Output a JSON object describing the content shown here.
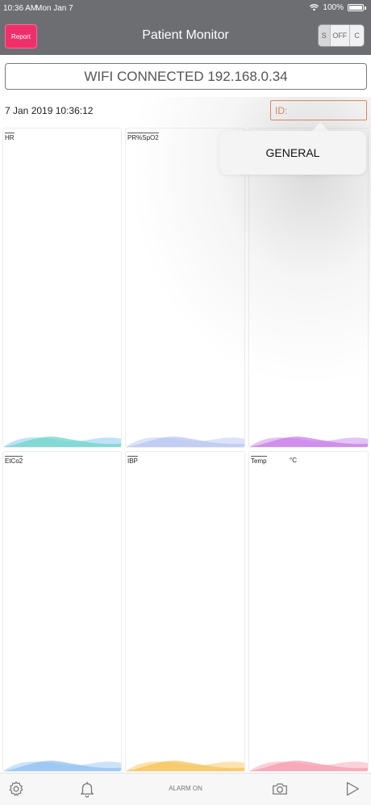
{
  "status_bar": {
    "time": "10:36 AM",
    "date": "Mon Jan 7",
    "battery": "100%"
  },
  "nav": {
    "report_label": "Report",
    "title": "Patient Monitor",
    "segments": [
      "S",
      "OFF",
      "C"
    ]
  },
  "wifi_status": "WIFI CONNECTED 192.168.0.34",
  "timestamp": "7 Jan 2019 10:36:12",
  "id_placeholder": "ID:",
  "popover": {
    "item": "GENERAL"
  },
  "panels": [
    {
      "label": "HR",
      "unit": "",
      "wave_color": "#6fd6c8",
      "wave_color2": "#a9d8f5"
    },
    {
      "label": "PR%SpO2",
      "unit": "",
      "wave_color": "#b9c6f2",
      "wave_color2": "#cfd9f7"
    },
    {
      "label": "",
      "unit": "",
      "wave_color": "#c97ee8",
      "wave_color2": "#d9b0f2"
    },
    {
      "label": "EtCo2",
      "unit": "",
      "wave_color": "#8fc0f2",
      "wave_color2": "#bcd9f7"
    },
    {
      "label": "IBP",
      "unit": "",
      "wave_color": "#f7c25a",
      "wave_color2": "#fbd98f"
    },
    {
      "label": "Temp",
      "unit": "°C",
      "wave_color": "#f59cb0",
      "wave_color2": "#f9c2ce"
    }
  ],
  "toolbar": {
    "alarm_label": "ALARM ON",
    "icons": [
      "gear-icon",
      "bell-icon",
      "camera-icon",
      "play-icon"
    ]
  },
  "colors": {
    "bar": "#6d6e72",
    "report": "#ee2f6a",
    "id_accent": "#e07a4b"
  }
}
